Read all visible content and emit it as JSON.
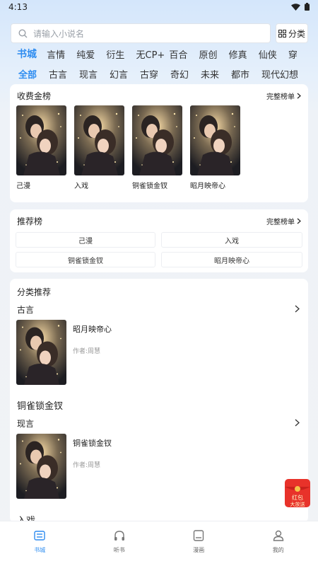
{
  "status": {
    "time": "4:13"
  },
  "search": {
    "placeholder": "请输入小说名",
    "category_label": "分类"
  },
  "tabs_primary": [
    "书城",
    "言情",
    "纯爱",
    "衍生",
    "无CP+",
    "百合",
    "原创",
    "修真",
    "仙侠",
    "穿"
  ],
  "tabs_secondary": [
    "全部",
    "古言",
    "现言",
    "幻言",
    "古穿",
    "奇幻",
    "未来",
    "都市",
    "现代幻想"
  ],
  "gold_list": {
    "title": "收费金榜",
    "more": "完整榜单",
    "books": [
      "己漫",
      "入戏",
      "铜雀锁金钗",
      "昭月映帝心"
    ]
  },
  "recommend_list": {
    "title": "推荐榜",
    "more": "完整榜单",
    "items": [
      "己漫",
      "入戏",
      "铜雀锁金钗",
      "昭月映帝心"
    ]
  },
  "category_rec": {
    "title": "分类推荐",
    "sections": [
      {
        "genre": "古言",
        "book": "昭月映帝心",
        "author": "作者:周慧"
      },
      {
        "heading": "铜雀锁金钗",
        "genre": "现言",
        "book": "铜雀锁金钗",
        "author": "作者:周慧"
      },
      {
        "heading": "入戏"
      }
    ]
  },
  "promo": {
    "label_line1": "红包",
    "label_line2": "大放送"
  },
  "bottom_nav": [
    {
      "label": "书城",
      "icon": "bookstore-icon"
    },
    {
      "label": "听书",
      "icon": "headphones-icon"
    },
    {
      "label": "漫画",
      "icon": "comic-icon"
    },
    {
      "label": "我的",
      "icon": "profile-icon"
    }
  ],
  "colors": {
    "accent": "#2d8cf0",
    "promo_red": "#e8322a"
  }
}
